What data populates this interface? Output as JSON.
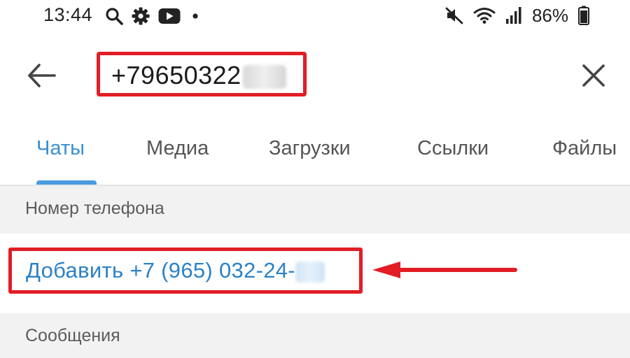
{
  "status_bar": {
    "time": "13:44",
    "battery_percent": "86%",
    "left_icons": [
      "search-icon",
      "gear-icon",
      "youtube-icon",
      "dot-icon"
    ],
    "right_icons": [
      "mute-icon",
      "wifi-icon",
      "signal-icon",
      "battery-icon"
    ]
  },
  "search": {
    "query": "+79650322"
  },
  "tabs": [
    {
      "label": "Чаты",
      "active": true
    },
    {
      "label": "Медиа",
      "active": false
    },
    {
      "label": "Загрузки",
      "active": false
    },
    {
      "label": "Ссылки",
      "active": false
    },
    {
      "label": "Файлы",
      "active": false
    }
  ],
  "sections": {
    "phone": {
      "title": "Номер телефона",
      "add_label": "Добавить +7 (965) 032-24-"
    },
    "messages": {
      "title": "Сообщения"
    }
  },
  "colors": {
    "accent": "#3a8fd0",
    "highlight": "#e21d25",
    "section_bg": "#f2f2f2"
  }
}
